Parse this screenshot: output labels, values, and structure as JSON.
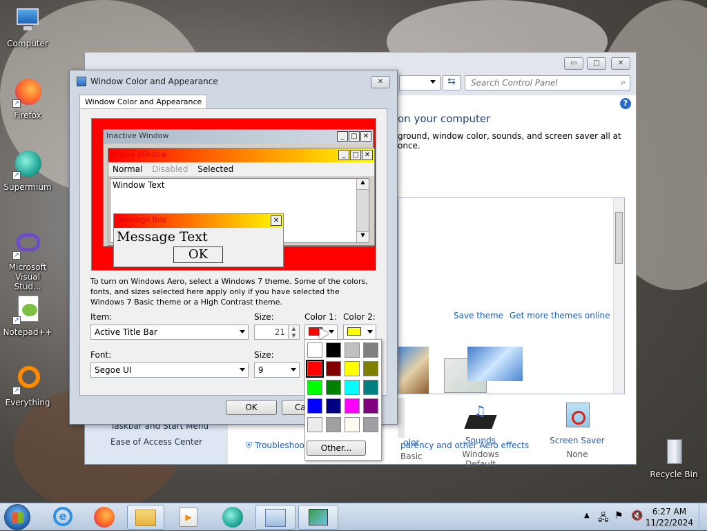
{
  "desktop": {
    "icons": [
      {
        "label": "Computer",
        "icon": "computer-icon"
      },
      {
        "label": "Firefox",
        "icon": "firefox-icon"
      },
      {
        "label": "Supermium",
        "icon": "supermium-icon"
      },
      {
        "label": "Microsoft Visual Stud...",
        "icon": "visual-studio-icon"
      },
      {
        "label": "Notepad++",
        "icon": "notepadpp-icon"
      },
      {
        "label": "Everything",
        "icon": "everything-icon"
      }
    ],
    "recycle_bin": "Recycle Bin"
  },
  "control_panel": {
    "search_placeholder": "Search Control Panel",
    "heading": "on your computer",
    "subtext": "ground, window color, sounds, and screen saver all at once.",
    "save_theme": "Save theme",
    "get_more_themes": "Get more themes online",
    "left_items": [
      "Taskbar and Start Menu",
      "Ease of Access Center"
    ],
    "bottom_items": [
      {
        "title": "olor",
        "sub": "Basic"
      },
      {
        "title": "Sounds",
        "sub": "Windows Default"
      },
      {
        "title": "Screen Saver",
        "sub": "None"
      }
    ],
    "troubleshoot": "Troubleshoo",
    "aero_link": "parency and other Aero effects"
  },
  "dialog": {
    "title": "Window Color and Appearance",
    "tab": "Window Color and Appearance",
    "preview": {
      "inactive": "Inactive Window",
      "active": "Active Window",
      "menu": [
        "Normal",
        "Disabled",
        "Selected"
      ],
      "window_text": "Window Text",
      "message_box": "Message Box",
      "message_text": "Message Text",
      "ok": "OK"
    },
    "info": "To turn on Windows Aero, select a Windows 7 theme.  Some of the colors, fonts, and sizes selected here apply only if you have selected the Windows 7 Basic theme or a High Contrast theme.",
    "item_label": "Item:",
    "item_value": "Active Title Bar",
    "size_label": "Size:",
    "size_value": "21",
    "color1_label": "Color 1:",
    "color2_label": "Color 2:",
    "color1": "#ff0000",
    "color2": "#ffff00",
    "font_label": "Font:",
    "font_value": "Segoe UI",
    "font_size_label": "Size:",
    "font_size_value": "9",
    "ok": "OK",
    "cancel": "Ca"
  },
  "palette": {
    "colors": [
      "#ffffff",
      "#000000",
      "#c0c0c0",
      "#808080",
      "#ff0000",
      "#800000",
      "#ffff00",
      "#808000",
      "#00ff00",
      "#008000",
      "#00ffff",
      "#008080",
      "#0000ff",
      "#000080",
      "#ff00ff",
      "#800080",
      "#ececec",
      "#a0a0a0",
      "#fffbf0",
      "#a0a0a4"
    ],
    "selected_index": 4,
    "other": "Other..."
  },
  "taskbar": {
    "time": "6:27 AM",
    "date": "11/22/2024"
  }
}
